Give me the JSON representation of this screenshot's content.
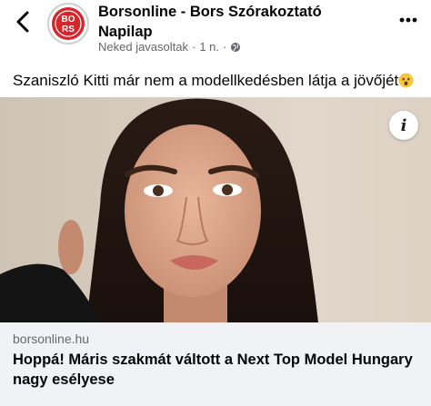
{
  "header": {
    "page_name": "Borsonline - Bors Szórakoztató Napilap",
    "meta_text": "Neked javasoltak",
    "meta_time": "1 n.",
    "dot": "·",
    "logo_text_top": "BO",
    "logo_text_bottom": "RS"
  },
  "post": {
    "text": "Szaniszló Kitti már nem a modellkedésben látja a jövőjét",
    "emoji": "hushed-face-emoji"
  },
  "image": {
    "info_label": "i"
  },
  "link_card": {
    "domain": "borsonline.hu",
    "headline": "Hoppá! Máris szakmát váltott a Next Top Model Hungary nagy esélyese"
  },
  "colors": {
    "brand_red": "#d7262b",
    "secondary_text": "#65676b",
    "card_bg": "#f0f2f5"
  }
}
